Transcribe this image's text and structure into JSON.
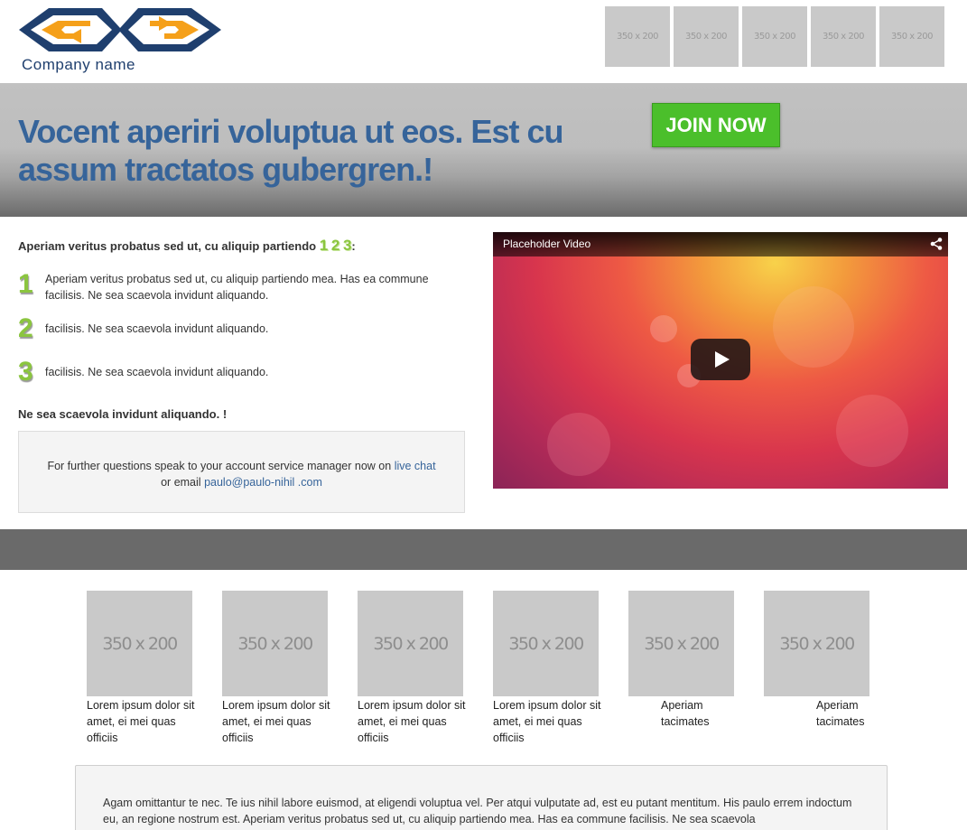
{
  "header": {
    "company_name": "Company name",
    "logo_colors": {
      "frame": "#1f3f6e",
      "arrows": "#f5a01a"
    },
    "top_thumbnails": [
      "350 x 200",
      "350 x 200",
      "350 x 200",
      "350 x 200",
      "350 x 200"
    ]
  },
  "hero": {
    "title": "Vocent aperiri voluptua ut eos. Est cu assum tractatos gubergren.!",
    "join_label": "JOIN NOW",
    "colors": {
      "title": "#36649a",
      "button": "#4bbf2b"
    }
  },
  "steps_section": {
    "intro_text": "Aperiam veritus probatus sed ut, cu aliquip partiendo",
    "intro_numbers": [
      "1",
      "2",
      "3"
    ],
    "intro_suffix": ":",
    "steps": [
      {
        "number": "1",
        "text": "Aperiam veritus probatus sed ut, cu aliquip partiendo mea. Has ea commune facilisis. Ne sea scaevola invidunt aliquando."
      },
      {
        "number": "2",
        "text": "facilisis. Ne sea scaevola invidunt aliquando."
      },
      {
        "number": "3",
        "text": "facilisis. Ne sea scaevola invidunt aliquando."
      }
    ],
    "note": "Ne sea scaevola invidunt aliquando. !",
    "accent_color": "#8bc53f"
  },
  "contact": {
    "text_before": "For further questions speak to your account service manager now on",
    "live_chat_label": "live chat",
    "text_middle": "or email",
    "email": "paulo@paulo-nihil .com"
  },
  "video": {
    "title": "Placeholder Video",
    "share_icon": "share-icon",
    "play_icon": "play-icon"
  },
  "gallery": {
    "items": [
      {
        "image_label": "350 x 200",
        "caption": "Lorem ipsum dolor sit amet, ei mei quas officiis"
      },
      {
        "image_label": "350 x 200",
        "caption": "Lorem ipsum dolor sit amet, ei mei quas officiis"
      },
      {
        "image_label": "350 x 200",
        "caption": "Lorem ipsum dolor sit amet, ei mei quas officiis"
      },
      {
        "image_label": "350 x 200",
        "caption": "Lorem ipsum dolor sit amet, ei mei quas officiis"
      },
      {
        "image_label": "350 x 200",
        "caption": "Aperiam tacimates"
      },
      {
        "image_label": "350 x 200",
        "caption": "Aperiam tacimates"
      }
    ]
  },
  "bottom_text": "Agam omittantur te nec. Te ius nihil labore euismod, at eligendi voluptua vel. Per atqui vulputate ad, est eu putant mentitum. His paulo errem indoctum eu, an regione nostrum est. Aperiam veritus probatus sed ut, cu aliquip partiendo mea. Has ea commune facilisis. Ne sea scaevola"
}
